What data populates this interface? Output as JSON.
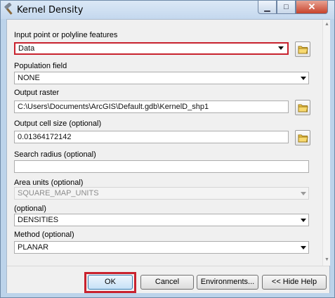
{
  "window": {
    "title": "Kernel Density",
    "title_icon": "hammer-icon",
    "minimize_glyph": "▁",
    "maximize_glyph": "□",
    "close_glyph": "✕"
  },
  "form": {
    "input_features": {
      "label": "Input point or polyline features",
      "value": "Data"
    },
    "population_field": {
      "label": "Population field",
      "value": "NONE"
    },
    "output_raster": {
      "label": "Output raster",
      "value": "C:\\Users\\Documents\\ArcGIS\\Default.gdb\\KernelD_shp1"
    },
    "cell_size": {
      "label": "Output cell size (optional)",
      "value": "0.01364172142"
    },
    "search_radius": {
      "label": "Search radius (optional)",
      "value": ""
    },
    "area_units": {
      "label": "Area units (optional)",
      "value": "SQUARE_MAP_UNITS"
    },
    "output_values": {
      "label": "(optional)",
      "value": "DENSITIES"
    },
    "method": {
      "label": "Method (optional)",
      "value": "PLANAR"
    }
  },
  "buttons": {
    "ok": "OK",
    "cancel": "Cancel",
    "environments": "Environments...",
    "hide_help": "<< Hide Help"
  },
  "colors": {
    "highlight": "#c8222e",
    "title_bar": "#c4d8ee",
    "close_button": "#c7432c"
  }
}
